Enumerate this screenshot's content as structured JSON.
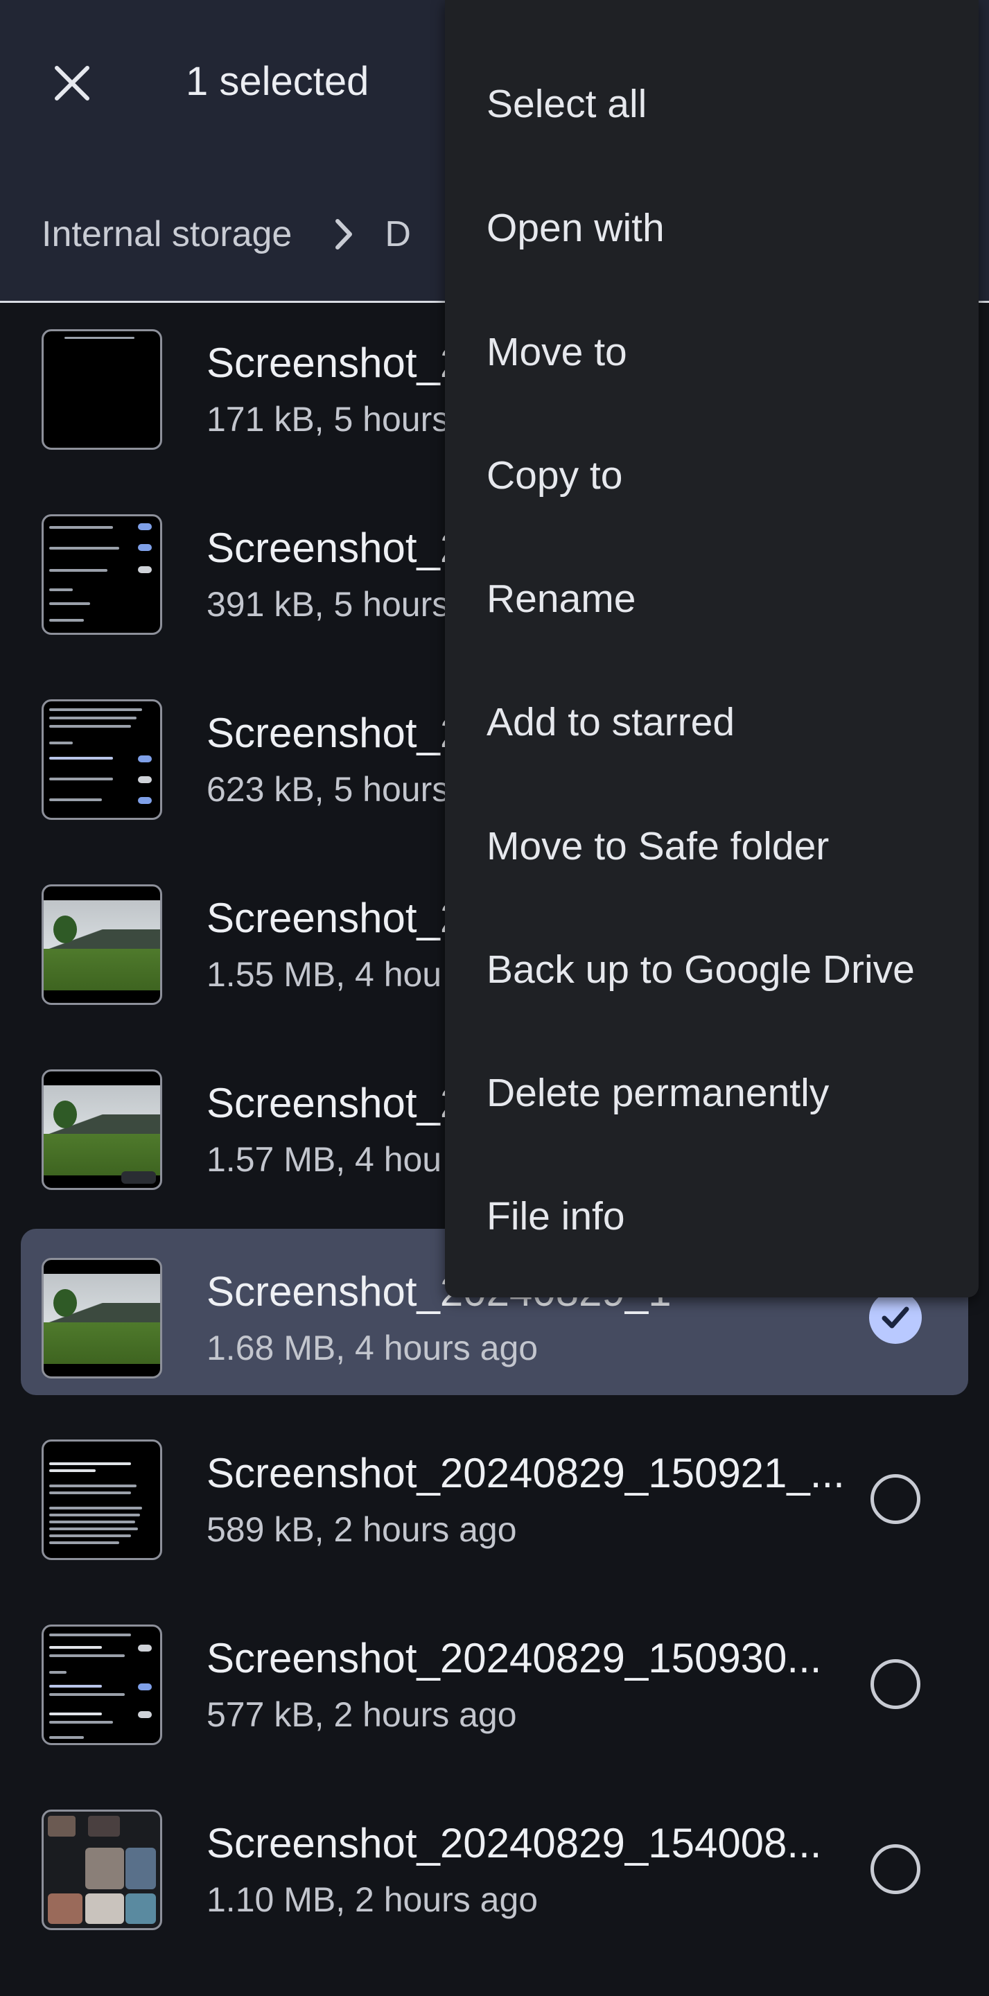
{
  "appbar": {
    "selection_title": "1 selected",
    "close_icon": "close-icon",
    "breadcrumb": {
      "root": "Internal storage",
      "separator_icon": "chevron-right-icon",
      "current": "D"
    }
  },
  "files": [
    {
      "name": "Screenshot_2",
      "meta": "171 kB, 5 hours",
      "thumb": "dark-blank",
      "selected": false
    },
    {
      "name": "Screenshot_2",
      "meta": "391 kB, 5 hours",
      "thumb": "settings-list",
      "selected": false
    },
    {
      "name": "Screenshot_2",
      "meta": "623 kB, 5 hours",
      "thumb": "settings-list",
      "selected": false
    },
    {
      "name": "Screenshot_2",
      "meta": "1.55 MB, 4 hou",
      "thumb": "landscape",
      "selected": false
    },
    {
      "name": "Screenshot_2",
      "meta": "1.57 MB, 4 hou",
      "thumb": "landscape",
      "selected": false
    },
    {
      "name": "Screenshot_20240829_1",
      "meta": "1.68 MB, 4 hours ago",
      "thumb": "landscape",
      "selected": true
    },
    {
      "name": "Screenshot_20240829_150921_...",
      "meta": "589 kB, 2 hours ago",
      "thumb": "settings-list",
      "selected": false
    },
    {
      "name": "Screenshot_20240829_150930...",
      "meta": "577 kB, 2 hours ago",
      "thumb": "settings-list",
      "selected": false
    },
    {
      "name": "Screenshot_20240829_154008...",
      "meta": "1.10 MB, 2 hours ago",
      "thumb": "photo-grid",
      "selected": false
    }
  ],
  "context_menu": {
    "items": [
      "Select all",
      "Open with",
      "Move to",
      "Copy to",
      "Rename",
      "Add to starred",
      "Move to Safe folder",
      "Back up to Google Drive",
      "Delete permanently",
      "File info"
    ]
  },
  "colors": {
    "appbar_bg": "#222634",
    "list_bg": "#121419",
    "menu_bg": "#1f2125",
    "selected_row_bg": "#454b60",
    "check_accent": "#b9c9ff"
  }
}
